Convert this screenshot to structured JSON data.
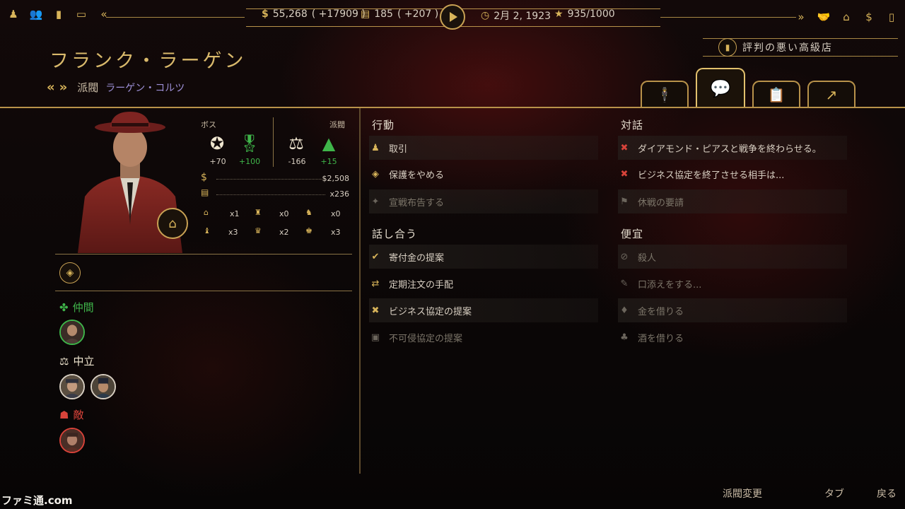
{
  "topbar": {
    "left_icons": [
      "mafia-icon",
      "crew-icon",
      "book-icon",
      "briefcase-icon",
      "collapse-icon"
    ],
    "money": "55,268",
    "money_delta": "( +17909 )",
    "pop": "185",
    "pop_delta": "( +207 )",
    "date": "2月 2, 1923",
    "score": "935/1000",
    "right_icons": [
      "expand-icon",
      "handshake-icon",
      "building-icon",
      "dollar-icon",
      "bottle-icon"
    ]
  },
  "character": {
    "name": "フランク・ラーゲン",
    "faction_label": "派閥",
    "faction_name": "ラーゲン・コルツ"
  },
  "reputation": {
    "label": "評判の悪い高級店"
  },
  "tabs": [
    {
      "name": "crew-tab",
      "icon": "gangsters-icon"
    },
    {
      "name": "diplomacy-tab",
      "icon": "speech-check-icon"
    },
    {
      "name": "ledger-tab",
      "icon": "clipboard-icon"
    },
    {
      "name": "growth-tab",
      "icon": "chart-up-icon"
    }
  ],
  "stats": {
    "boss_header": "ボス",
    "faction_header": "派閥",
    "boss_star": "+70",
    "boss_medal": "+100",
    "faction_scale": "-166",
    "faction_warning": "+15",
    "money": "$2,508",
    "buildings": "x236",
    "grid": [
      [
        "x1",
        "x0",
        "x0"
      ],
      [
        "x3",
        "x2",
        "x3"
      ]
    ]
  },
  "relations": {
    "allies": "仲間",
    "neutral": "中立",
    "enemies": "敵"
  },
  "actions": {
    "act_title": "行動",
    "act": [
      {
        "label": "取引",
        "enabled": true,
        "icon": "deal-icon"
      },
      {
        "label": "保護をやめる",
        "enabled": true,
        "icon": "shield-icon"
      },
      {
        "label": "宣戦布告する",
        "enabled": false,
        "icon": "gun-icon"
      }
    ],
    "talk_title": "話し合う",
    "talk": [
      {
        "label": "寄付金の提案",
        "enabled": true,
        "icon": "donation-icon"
      },
      {
        "label": "定期注文の手配",
        "enabled": true,
        "icon": "exchange-icon"
      },
      {
        "label": "ビジネス協定の提案",
        "enabled": true,
        "icon": "contract-icon"
      },
      {
        "label": "不可侵協定の提案",
        "enabled": false,
        "icon": "pact-icon"
      }
    ],
    "dialog_title": "対話",
    "dialog": [
      {
        "label": "ダイアモンド・ピアスと戦争を終わらせる。",
        "enabled": true,
        "icon": "end-war-icon"
      },
      {
        "label": "ビジネス協定を終了させる相手は...",
        "enabled": true,
        "icon": "end-contract-icon"
      },
      {
        "label": "休戦の要請",
        "enabled": false,
        "icon": "flag-icon"
      }
    ],
    "favor_title": "便宜",
    "favor": [
      {
        "label": "殺人",
        "enabled": false,
        "icon": "target-icon"
      },
      {
        "label": "口添えをする...",
        "enabled": false,
        "icon": "speech-icon"
      },
      {
        "label": "金を借りる",
        "enabled": false,
        "icon": "moneybag-icon"
      },
      {
        "label": "酒を借りる",
        "enabled": false,
        "icon": "liquor-icon"
      }
    ]
  },
  "footer": {
    "change_faction": "派閥変更",
    "tab": "タブ",
    "back": "戻る"
  },
  "watermark": "ファミ通.com",
  "colors": {
    "gold": "#d8b45a",
    "ally": "#3fb54a",
    "enemy": "#d8433a",
    "faction_name": "#9d8fd6"
  }
}
